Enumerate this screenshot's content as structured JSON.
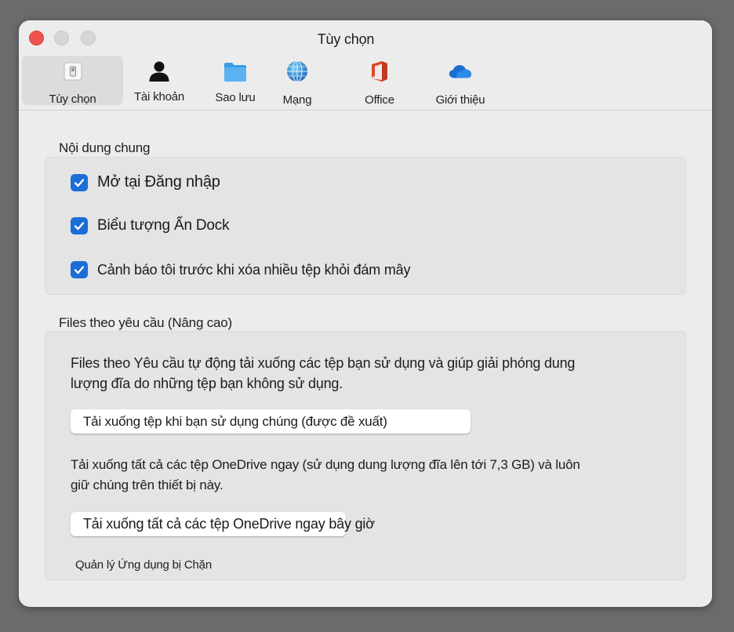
{
  "window": {
    "title": "Tùy chọn",
    "controls": [
      "close",
      "minimize",
      "maximize"
    ]
  },
  "tabs": [
    {
      "label": "Tùy chọn",
      "icon": "switch-icon",
      "selected": true
    },
    {
      "label": "Tài khoản",
      "icon": "person-icon",
      "selected": false
    },
    {
      "label": "Sao lưu",
      "icon": "folder-icon",
      "selected": false
    },
    {
      "label": "Mạng",
      "icon": "globe-icon",
      "selected": false
    },
    {
      "label": "Office",
      "icon": "office-icon",
      "selected": false
    },
    {
      "label": "Giới thiệu",
      "icon": "cloud-icon",
      "selected": false
    }
  ],
  "general": {
    "title": "Nội dung chung",
    "options": [
      {
        "label": "Mở tại Đăng nhập",
        "checked": true
      },
      {
        "label": "Biểu tượng Ẩn Dock",
        "checked": true
      },
      {
        "label": "Cảnh báo tôi trước khi xóa nhiều tệp khỏi đám mây",
        "checked": true
      }
    ]
  },
  "files_on_demand": {
    "title": "Files theo yêu cầu (Nâng cao)",
    "description_line1": "Files theo Yêu cầu tự động tải xuống các tệp bạn sử dụng và giúp giải phóng dung",
    "description_line2": "lượng đĩa do những tệp bạn không sử dụng.",
    "download_when_used_button": "Tải xuống tệp khi bạn sử dụng chúng (được đề xuất)",
    "download_all_desc_line1": "Tải xuống tất cả các tệp OneDrive ngay (sử dụng dung lượng đĩa lên tới 7,3 GB) và luôn",
    "download_all_desc_line2": "giữ chúng trên thiết bị này.",
    "download_all_button": "Tải xuống tất cả các tệp OneDrive ngay bây giờ",
    "manage_blocked_apps": "Quản lý Ứng dụng bị Chặn"
  },
  "colors": {
    "accent": "#1b6ed6",
    "close_button": "#ef5350",
    "window_bg": "#ececec",
    "group_bg": "#e4e4e4",
    "desktop_bg": "#6b6b6b"
  }
}
